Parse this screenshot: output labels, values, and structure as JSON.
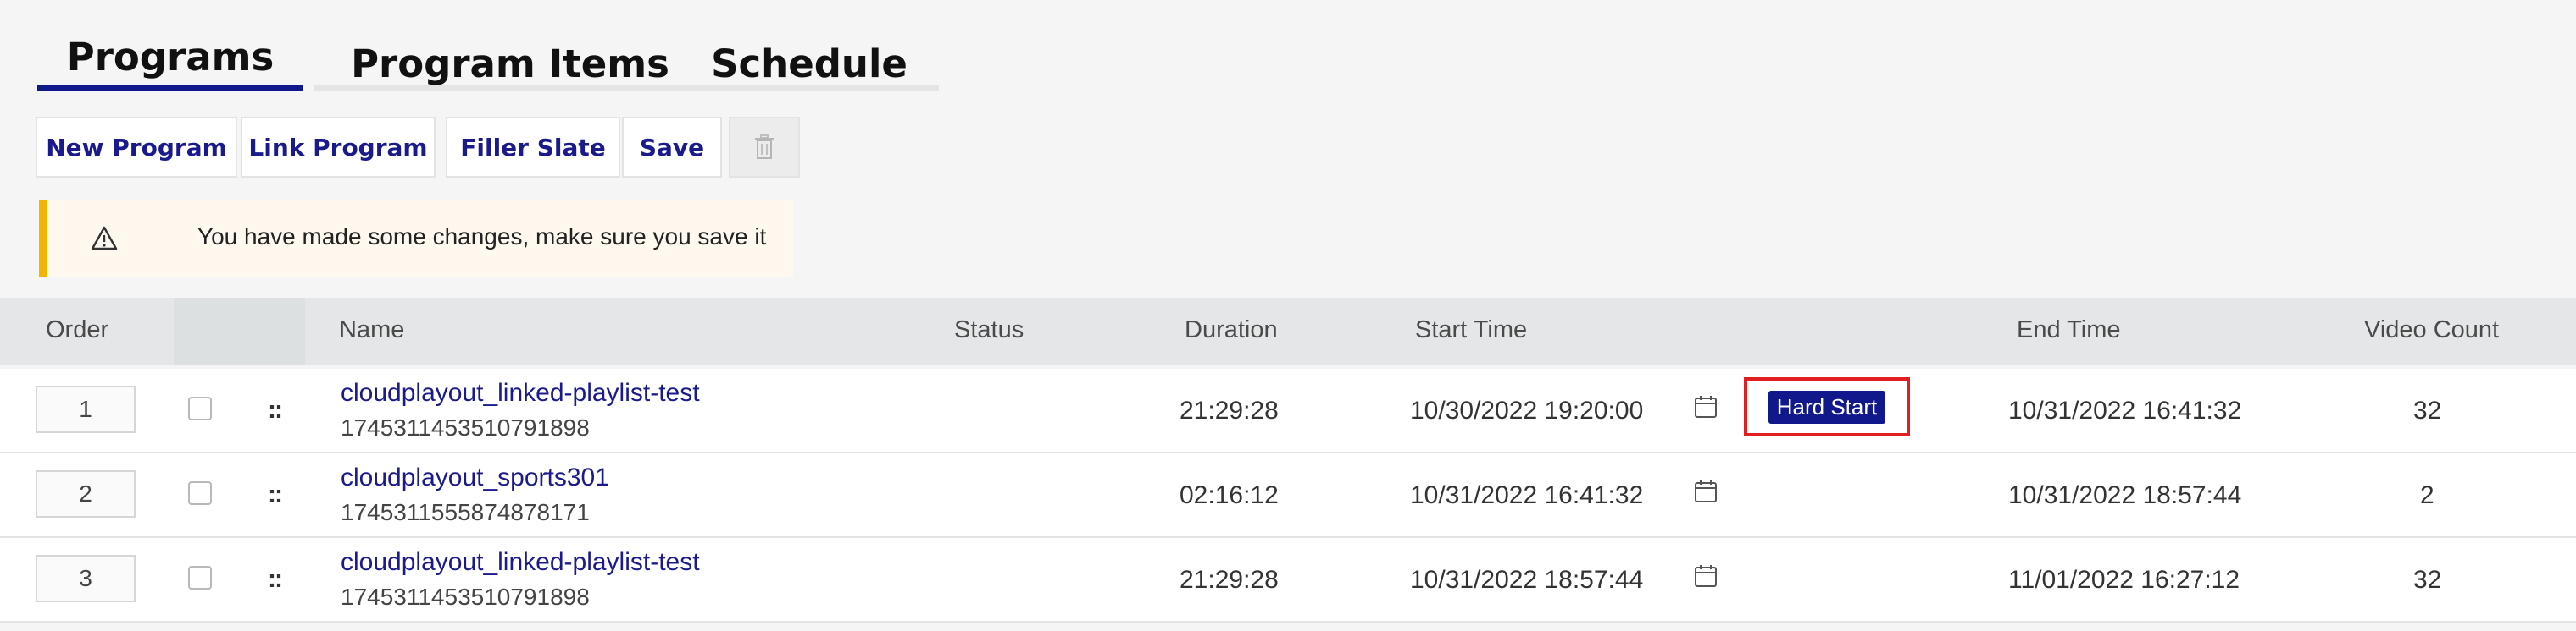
{
  "tabs": [
    {
      "label": "Programs",
      "active": true
    },
    {
      "label": "Program Items",
      "active": false
    },
    {
      "label": "Schedule",
      "active": false
    }
  ],
  "toolbar": {
    "new_program": "New Program",
    "link_program": "Link Program",
    "filler_slate": "Filler Slate",
    "save": "Save",
    "delete_icon": "trash-icon"
  },
  "alert": {
    "icon": "warning-icon",
    "text": "You have made some changes, make sure you save it",
    "accent_color": "#f5b400"
  },
  "table": {
    "headers": {
      "order": "Order",
      "name": "Name",
      "status": "Status",
      "duration": "Duration",
      "start_time": "Start Time",
      "end_time": "End Time",
      "video_count": "Video Count"
    },
    "rows": [
      {
        "order": "1",
        "name": "cloudplayout_linked-playlist-test",
        "id": "1745311453510791898",
        "status": "",
        "duration": "21:29:28",
        "start_time": "10/30/2022 19:20:00",
        "badge": "Hard Start",
        "end_time": "10/31/2022 16:41:32",
        "video_count": "32"
      },
      {
        "order": "2",
        "name": "cloudplayout_sports301",
        "id": "1745311555874878171",
        "status": "",
        "duration": "02:16:12",
        "start_time": "10/31/2022 16:41:32",
        "badge": "",
        "end_time": "10/31/2022 18:57:44",
        "video_count": "2"
      },
      {
        "order": "3",
        "name": "cloudplayout_linked-playlist-test",
        "id": "1745311453510791898",
        "status": "",
        "duration": "21:29:28",
        "start_time": "10/31/2022 18:57:44",
        "badge": "",
        "end_time": "11/01/2022 16:27:12",
        "video_count": "32"
      }
    ]
  },
  "colors": {
    "brand": "#10188c",
    "highlight": "#e02020",
    "warning": "#f5b400"
  }
}
